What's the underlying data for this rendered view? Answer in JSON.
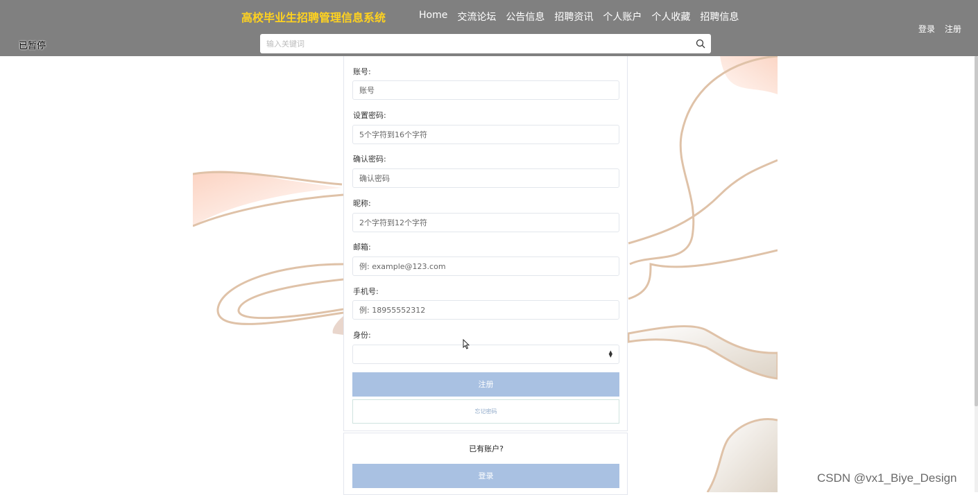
{
  "header": {
    "site_title": "高校毕业生招聘管理信息系统",
    "nav": [
      "Home",
      "交流论坛",
      "公告信息",
      "招聘资讯",
      "个人账户",
      "个人收藏",
      "招聘信息"
    ],
    "login": "登录",
    "register": "注册",
    "search_placeholder": "输入关键词",
    "paused": "已暂停"
  },
  "form": {
    "account_label": "账号:",
    "account_placeholder": "账号",
    "password_label": "设置密码:",
    "password_placeholder": "5个字符到16个字符",
    "confirm_label": "确认密码:",
    "confirm_placeholder": "确认密码",
    "nickname_label": "昵称:",
    "nickname_placeholder": "2个字符到12个字符",
    "email_label": "邮箱:",
    "email_placeholder": "例: example@123.com",
    "phone_label": "手机号:",
    "phone_placeholder": "例: 18955552312",
    "identity_label": "身份:",
    "identity_value": "",
    "register_button": "注册",
    "forgot_button": "忘记密码"
  },
  "login_box": {
    "prompt": "已有账户?",
    "login_button": "登录"
  },
  "watermark": "CSDN @vx1_Biye_Design",
  "icons": {
    "search": "search-icon",
    "select": "select-arrows-icon",
    "cursor": "mouse-cursor-icon"
  },
  "colors": {
    "topbar": "#808080",
    "title": "#ffd21f",
    "primary_button": "#a9c1e2"
  }
}
